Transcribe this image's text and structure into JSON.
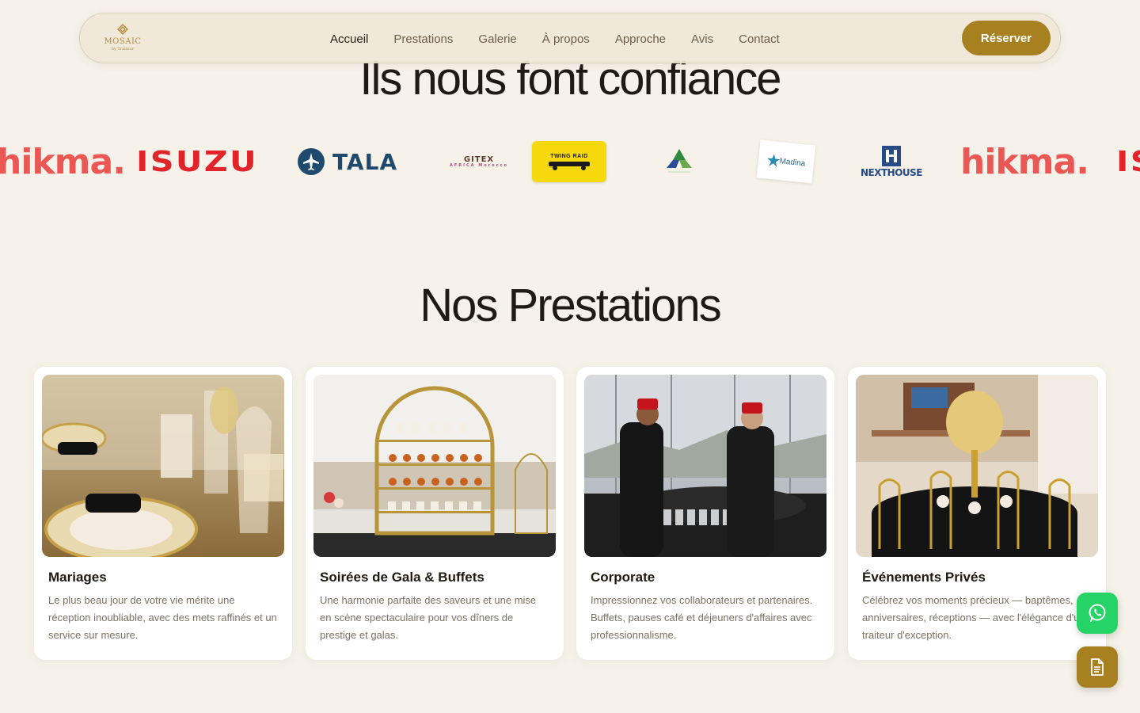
{
  "brand": {
    "logo_text": "MOSAIC",
    "logo_subtext": "by Traiteur",
    "accent_color": "#a7801f"
  },
  "nav": {
    "links": [
      {
        "label": "Accueil",
        "active": true
      },
      {
        "label": "Prestations",
        "active": false
      },
      {
        "label": "Galerie",
        "active": false
      },
      {
        "label": "À propos",
        "active": false
      },
      {
        "label": "Approche",
        "active": false
      },
      {
        "label": "Avis",
        "active": false
      },
      {
        "label": "Contact",
        "active": false
      }
    ],
    "cta_label": "Réserver"
  },
  "trust": {
    "title": "Ils nous font confiance",
    "partners": [
      {
        "name": "hikma.",
        "icon": "hikma-logo"
      },
      {
        "name": "ISUZU",
        "icon": "isuzu-logo"
      },
      {
        "name": "TALA",
        "icon": "tala-logo"
      },
      {
        "name": "GITEX",
        "subtitle": "AFRICA Morocco",
        "icon": "gitex-logo"
      },
      {
        "name": "TWING RAID",
        "icon": "twing-raid-logo"
      },
      {
        "name": "",
        "icon": "triangle-leaf-logo"
      },
      {
        "name": "Madina",
        "icon": "madina-logo"
      },
      {
        "name": "NEXTHOUSE",
        "icon": "nexthouse-logo"
      },
      {
        "name": "hikma.",
        "icon": "hikma-logo"
      },
      {
        "name": "IS",
        "icon": "isuzu-logo"
      }
    ]
  },
  "prestations": {
    "title": "Nos Prestations",
    "cards": [
      {
        "title": "Mariages",
        "description": "Le plus beau jour de votre vie mérite une réception inoubliable, avec des mets raffinés et un service sur mesure.",
        "image": "table-setting-photo"
      },
      {
        "title": "Soirées de Gala & Buffets",
        "description": "Une harmonie parfaite des saveurs et une mise en scène spectaculaire pour vos dîners de prestige et galas.",
        "image": "dessert-display-photo"
      },
      {
        "title": "Corporate",
        "description": "Impressionnez vos collaborateurs et partenaires. Buffets, pauses café et déjeuners d'affaires avec professionnalisme.",
        "image": "waiters-service-photo"
      },
      {
        "title": "Événements Privés",
        "description": "Célébrez vos moments précieux — baptêmes, anniversaires, réceptions — avec l'élégance d'un traiteur d'exception.",
        "image": "private-dining-photo"
      }
    ]
  },
  "floating": {
    "whatsapp_icon": "whatsapp-icon",
    "doc_icon": "document-icon"
  }
}
